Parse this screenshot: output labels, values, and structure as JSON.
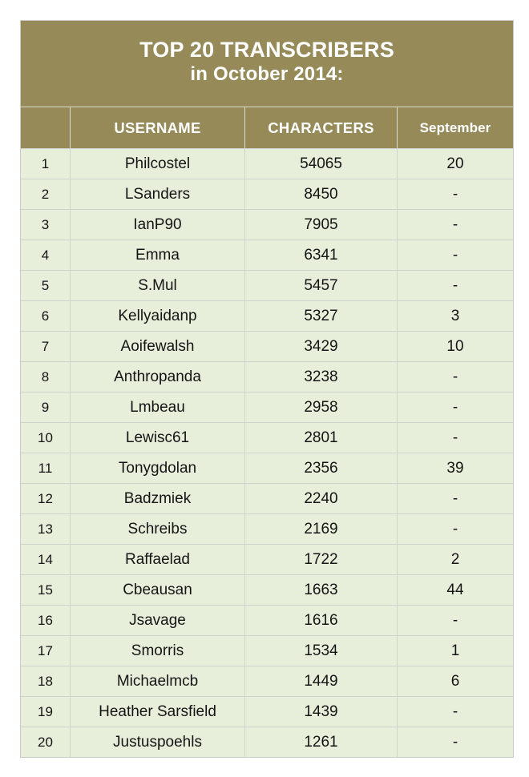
{
  "title": {
    "line1": "TOP 20 TRANSCRIBERS",
    "line2": "in October 2014:"
  },
  "columns": {
    "rank": "",
    "username": "USERNAME",
    "characters": "CHARACTERS",
    "september": "September"
  },
  "colors": {
    "header_gold": "#968b58",
    "row_background": "#e7eeda",
    "grid_line": "#cfd4cb",
    "text": "#151515",
    "header_text": "#ffffff"
  },
  "rows": [
    {
      "rank": "1",
      "username": "Philcostel",
      "characters": "54065",
      "september": "20"
    },
    {
      "rank": "2",
      "username": "LSanders",
      "characters": "8450",
      "september": "-"
    },
    {
      "rank": "3",
      "username": "IanP90",
      "characters": "7905",
      "september": "-"
    },
    {
      "rank": "4",
      "username": "Emma",
      "characters": "6341",
      "september": "-"
    },
    {
      "rank": "5",
      "username": "S.Mul",
      "characters": "5457",
      "september": "-"
    },
    {
      "rank": "6",
      "username": "Kellyaidanp",
      "characters": "5327",
      "september": "3"
    },
    {
      "rank": "7",
      "username": "Aoifewalsh",
      "characters": "3429",
      "september": "10"
    },
    {
      "rank": "8",
      "username": "Anthropanda",
      "characters": "3238",
      "september": "-"
    },
    {
      "rank": "9",
      "username": "Lmbeau",
      "characters": "2958",
      "september": "-"
    },
    {
      "rank": "10",
      "username": "Lewisc61",
      "characters": "2801",
      "september": "-"
    },
    {
      "rank": "11",
      "username": "Tonygdolan",
      "characters": "2356",
      "september": "39"
    },
    {
      "rank": "12",
      "username": "Badzmiek",
      "characters": "2240",
      "september": "-"
    },
    {
      "rank": "13",
      "username": "Schreibs",
      "characters": "2169",
      "september": "-"
    },
    {
      "rank": "14",
      "username": "Raffaelad",
      "characters": "1722",
      "september": "2"
    },
    {
      "rank": "15",
      "username": "Cbeausan",
      "characters": "1663",
      "september": "44"
    },
    {
      "rank": "16",
      "username": "Jsavage",
      "characters": "1616",
      "september": "-"
    },
    {
      "rank": "17",
      "username": "Smorris",
      "characters": "1534",
      "september": "1"
    },
    {
      "rank": "18",
      "username": "Michaelmcb",
      "characters": "1449",
      "september": "6"
    },
    {
      "rank": "19",
      "username": "Heather Sarsfield",
      "characters": "1439",
      "september": "-"
    },
    {
      "rank": "20",
      "username": "Justuspoehls",
      "characters": "1261",
      "september": "-"
    }
  ]
}
